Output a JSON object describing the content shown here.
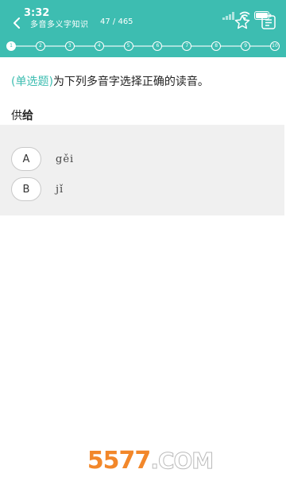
{
  "status_bar": {
    "time": "3:32",
    "icons": [
      "signal-icon",
      "wifi-icon",
      "battery-icon"
    ]
  },
  "nav": {
    "title": "多音多义字知识",
    "progress": "47 / 465",
    "icons": [
      "back-arrow-icon",
      "star-icon",
      "answer-card-icon"
    ]
  },
  "progress_dots": {
    "labels": [
      "1",
      "2",
      "3",
      "4",
      "5",
      "6",
      "7",
      "8",
      "9",
      "10"
    ],
    "active_label": "1"
  },
  "question": {
    "type_label": "(单选题)",
    "prompt": "为下列多音字选择正确的读音。",
    "word_prefix": "供",
    "word_emphasis": "给"
  },
  "options": [
    {
      "letter": "A",
      "text": "gěi"
    },
    {
      "letter": "B",
      "text": "jǐ"
    }
  ],
  "watermark": {
    "number": "5577",
    "domain": ".COM"
  },
  "colors": {
    "accent": "#3dbdb1",
    "option_panel": "#f0f0f0"
  }
}
